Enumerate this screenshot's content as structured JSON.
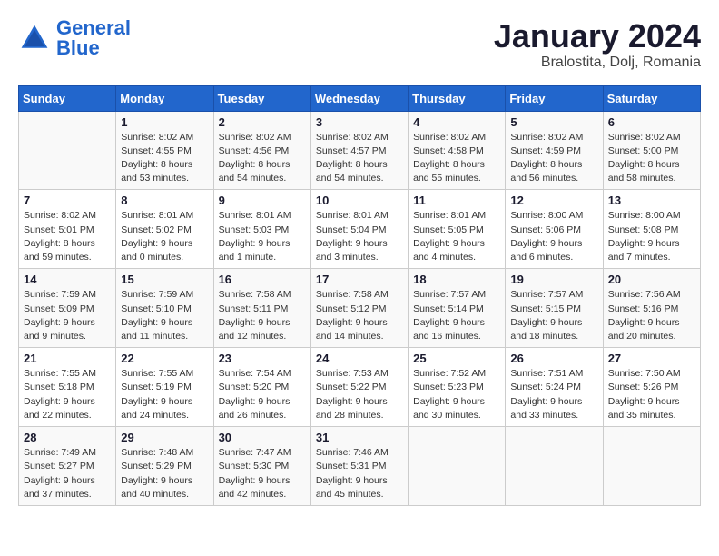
{
  "logo": {
    "text_general": "General",
    "text_blue": "Blue"
  },
  "header": {
    "title": "January 2024",
    "subtitle": "Bralostita, Dolj, Romania"
  },
  "weekdays": [
    "Sunday",
    "Monday",
    "Tuesday",
    "Wednesday",
    "Thursday",
    "Friday",
    "Saturday"
  ],
  "weeks": [
    [
      {
        "day": "",
        "info": ""
      },
      {
        "day": "1",
        "info": "Sunrise: 8:02 AM\nSunset: 4:55 PM\nDaylight: 8 hours\nand 53 minutes."
      },
      {
        "day": "2",
        "info": "Sunrise: 8:02 AM\nSunset: 4:56 PM\nDaylight: 8 hours\nand 54 minutes."
      },
      {
        "day": "3",
        "info": "Sunrise: 8:02 AM\nSunset: 4:57 PM\nDaylight: 8 hours\nand 54 minutes."
      },
      {
        "day": "4",
        "info": "Sunrise: 8:02 AM\nSunset: 4:58 PM\nDaylight: 8 hours\nand 55 minutes."
      },
      {
        "day": "5",
        "info": "Sunrise: 8:02 AM\nSunset: 4:59 PM\nDaylight: 8 hours\nand 56 minutes."
      },
      {
        "day": "6",
        "info": "Sunrise: 8:02 AM\nSunset: 5:00 PM\nDaylight: 8 hours\nand 58 minutes."
      }
    ],
    [
      {
        "day": "7",
        "info": "Sunrise: 8:02 AM\nSunset: 5:01 PM\nDaylight: 8 hours\nand 59 minutes."
      },
      {
        "day": "8",
        "info": "Sunrise: 8:01 AM\nSunset: 5:02 PM\nDaylight: 9 hours\nand 0 minutes."
      },
      {
        "day": "9",
        "info": "Sunrise: 8:01 AM\nSunset: 5:03 PM\nDaylight: 9 hours\nand 1 minute."
      },
      {
        "day": "10",
        "info": "Sunrise: 8:01 AM\nSunset: 5:04 PM\nDaylight: 9 hours\nand 3 minutes."
      },
      {
        "day": "11",
        "info": "Sunrise: 8:01 AM\nSunset: 5:05 PM\nDaylight: 9 hours\nand 4 minutes."
      },
      {
        "day": "12",
        "info": "Sunrise: 8:00 AM\nSunset: 5:06 PM\nDaylight: 9 hours\nand 6 minutes."
      },
      {
        "day": "13",
        "info": "Sunrise: 8:00 AM\nSunset: 5:08 PM\nDaylight: 9 hours\nand 7 minutes."
      }
    ],
    [
      {
        "day": "14",
        "info": "Sunrise: 7:59 AM\nSunset: 5:09 PM\nDaylight: 9 hours\nand 9 minutes."
      },
      {
        "day": "15",
        "info": "Sunrise: 7:59 AM\nSunset: 5:10 PM\nDaylight: 9 hours\nand 11 minutes."
      },
      {
        "day": "16",
        "info": "Sunrise: 7:58 AM\nSunset: 5:11 PM\nDaylight: 9 hours\nand 12 minutes."
      },
      {
        "day": "17",
        "info": "Sunrise: 7:58 AM\nSunset: 5:12 PM\nDaylight: 9 hours\nand 14 minutes."
      },
      {
        "day": "18",
        "info": "Sunrise: 7:57 AM\nSunset: 5:14 PM\nDaylight: 9 hours\nand 16 minutes."
      },
      {
        "day": "19",
        "info": "Sunrise: 7:57 AM\nSunset: 5:15 PM\nDaylight: 9 hours\nand 18 minutes."
      },
      {
        "day": "20",
        "info": "Sunrise: 7:56 AM\nSunset: 5:16 PM\nDaylight: 9 hours\nand 20 minutes."
      }
    ],
    [
      {
        "day": "21",
        "info": "Sunrise: 7:55 AM\nSunset: 5:18 PM\nDaylight: 9 hours\nand 22 minutes."
      },
      {
        "day": "22",
        "info": "Sunrise: 7:55 AM\nSunset: 5:19 PM\nDaylight: 9 hours\nand 24 minutes."
      },
      {
        "day": "23",
        "info": "Sunrise: 7:54 AM\nSunset: 5:20 PM\nDaylight: 9 hours\nand 26 minutes."
      },
      {
        "day": "24",
        "info": "Sunrise: 7:53 AM\nSunset: 5:22 PM\nDaylight: 9 hours\nand 28 minutes."
      },
      {
        "day": "25",
        "info": "Sunrise: 7:52 AM\nSunset: 5:23 PM\nDaylight: 9 hours\nand 30 minutes."
      },
      {
        "day": "26",
        "info": "Sunrise: 7:51 AM\nSunset: 5:24 PM\nDaylight: 9 hours\nand 33 minutes."
      },
      {
        "day": "27",
        "info": "Sunrise: 7:50 AM\nSunset: 5:26 PM\nDaylight: 9 hours\nand 35 minutes."
      }
    ],
    [
      {
        "day": "28",
        "info": "Sunrise: 7:49 AM\nSunset: 5:27 PM\nDaylight: 9 hours\nand 37 minutes."
      },
      {
        "day": "29",
        "info": "Sunrise: 7:48 AM\nSunset: 5:29 PM\nDaylight: 9 hours\nand 40 minutes."
      },
      {
        "day": "30",
        "info": "Sunrise: 7:47 AM\nSunset: 5:30 PM\nDaylight: 9 hours\nand 42 minutes."
      },
      {
        "day": "31",
        "info": "Sunrise: 7:46 AM\nSunset: 5:31 PM\nDaylight: 9 hours\nand 45 minutes."
      },
      {
        "day": "",
        "info": ""
      },
      {
        "day": "",
        "info": ""
      },
      {
        "day": "",
        "info": ""
      }
    ]
  ]
}
